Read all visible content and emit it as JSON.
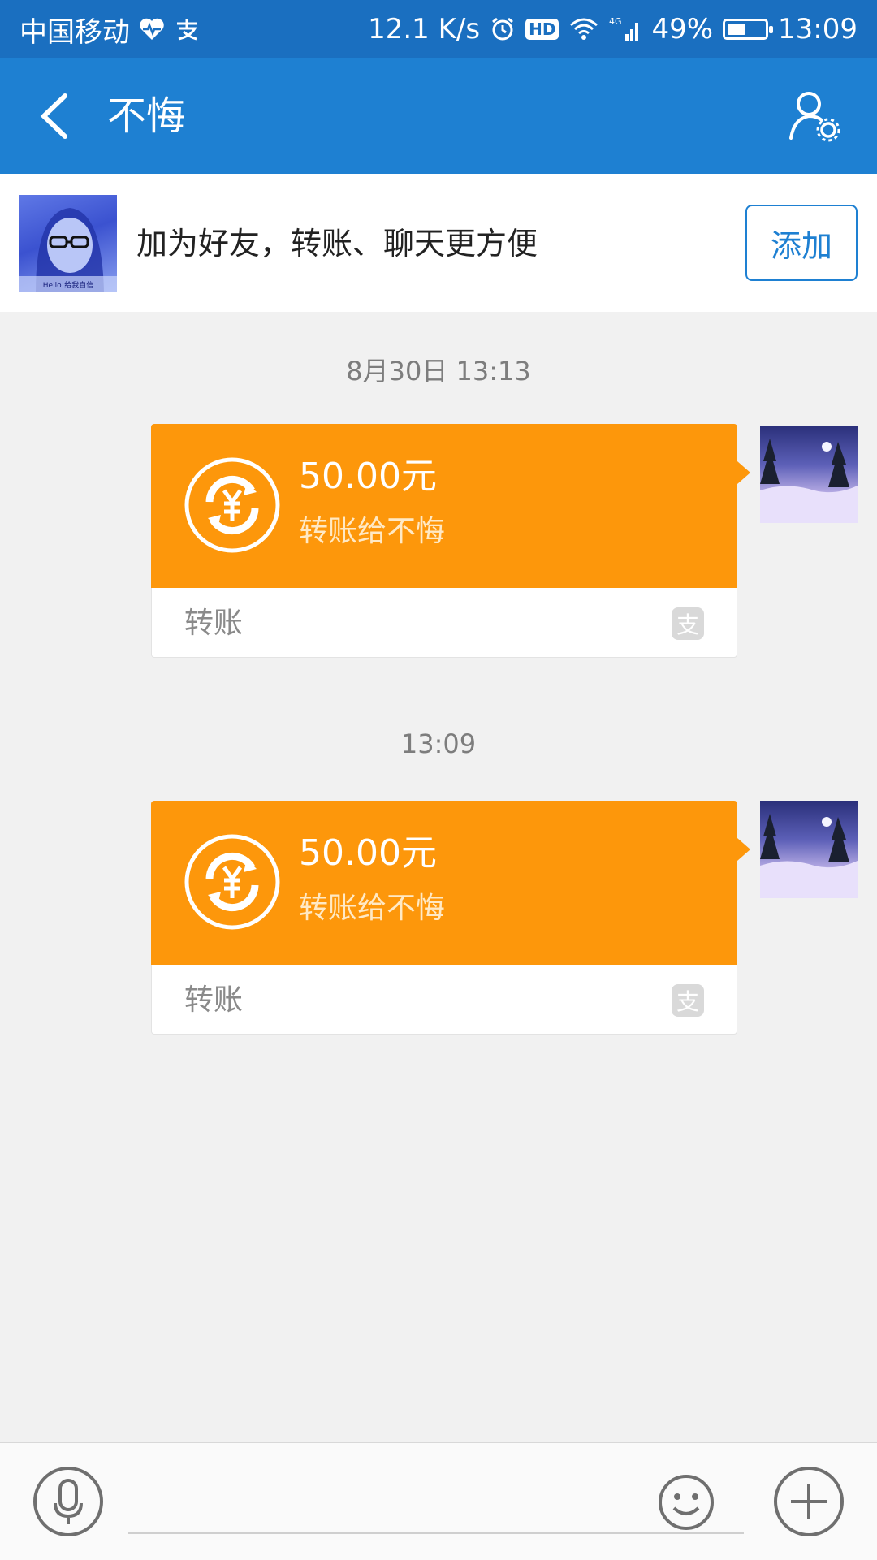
{
  "status_bar": {
    "carrier": "中国移动",
    "net_speed": "12.1 K/s",
    "hd_label": "HD",
    "network_label": "4G",
    "battery_level": 0.49,
    "battery_percent": "49%",
    "time": "13:09",
    "icons": [
      "heart-pulse-icon",
      "alipay-icon",
      "alarm-icon",
      "hd-icon",
      "wifi-icon",
      "signal-icon",
      "battery-icon"
    ]
  },
  "header": {
    "title": "不悔",
    "back_icon": "back-arrow-icon",
    "profile_icon": "user-settings-icon"
  },
  "friend_banner": {
    "avatar_caption": "Hello!给我自信",
    "text": "加为好友，转账、聊天更方便",
    "add_label": "添加"
  },
  "messages": [
    {
      "timestamp": "8月30日 13:13",
      "amount": "50.00元",
      "to": "转账给不悔",
      "type": "转账",
      "alipay_mark": "支"
    },
    {
      "timestamp": "13:09",
      "amount": "50.00元",
      "to": "转账给不悔",
      "type": "转账",
      "alipay_mark": "支"
    }
  ],
  "input_bar": {
    "placeholder": "",
    "voice_icon": "microphone-icon",
    "emoji_icon": "emoji-icon",
    "plus_icon": "plus-icon"
  },
  "colors": {
    "status_bar": "#1a6fc0",
    "header": "#1e80d2",
    "transfer_card": "#fd970b",
    "background": "#f1f1f1"
  }
}
